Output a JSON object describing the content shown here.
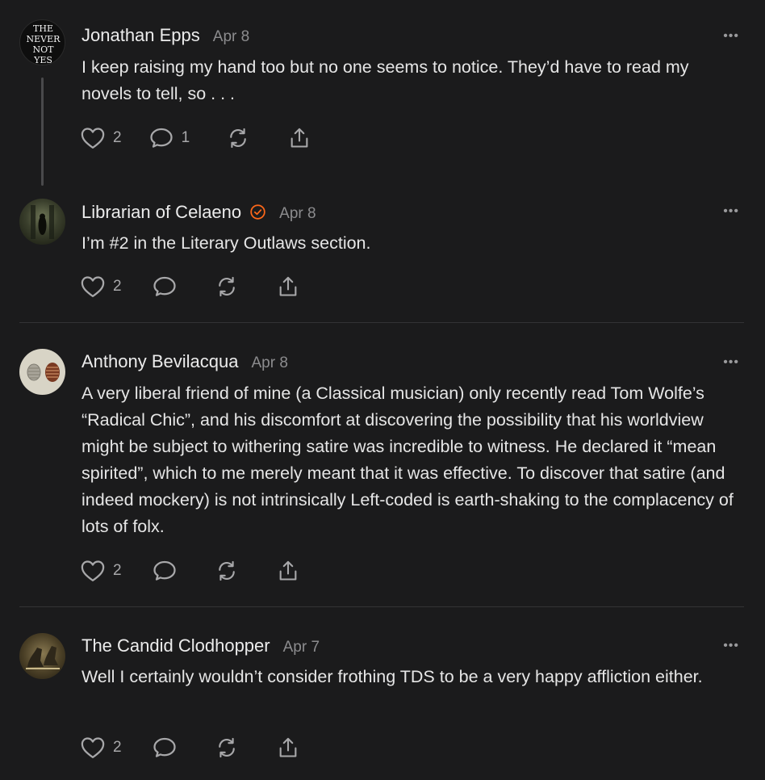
{
  "comments": [
    {
      "author": "Jonathan Epps",
      "date": "Apr 8",
      "avatar_text": [
        "THE",
        "NEVER",
        "NOT",
        "YES"
      ],
      "text": "I keep raising my hand too but no one seems to notice. They’d have to read my novels to tell, so . . .",
      "likes": "2",
      "replies": "1",
      "verified": false
    },
    {
      "author": "Librarian of Celaeno",
      "date": "Apr 8",
      "text": "I’m #2 in the Literary Outlaws section.",
      "likes": "2",
      "replies": "",
      "verified": true
    },
    {
      "author": "Anthony Bevilacqua",
      "date": "Apr 8",
      "text": "A very liberal friend of mine (a Classical musician) only recently read Tom Wolfe’s “Radical Chic”, and his discomfort at discovering the possibility that his worldview might be subject to withering satire was incredible to witness. He declared it “mean spirited”, which to me merely meant that it was effective. To discover that satire (and indeed mockery) is not intrinsically Left-coded is earth-shaking to the complacency of lots of folx.",
      "likes": "2",
      "replies": "",
      "verified": false
    },
    {
      "author": "The Candid Clodhopper",
      "date": "Apr 7",
      "text": "Well I certainly wouldn’t consider frothing TDS to be a very happy affliction either.",
      "likes": "2",
      "replies": "",
      "verified": false
    }
  ],
  "more_label": "•••",
  "colors": {
    "background": "#1b1b1c",
    "text": "#e6e6e6",
    "muted": "#8c8c8e",
    "verified": "#ff6719"
  },
  "icons": [
    "heart-icon",
    "comment-icon",
    "restack-icon",
    "share-icon",
    "more-icon",
    "verified-icon"
  ]
}
